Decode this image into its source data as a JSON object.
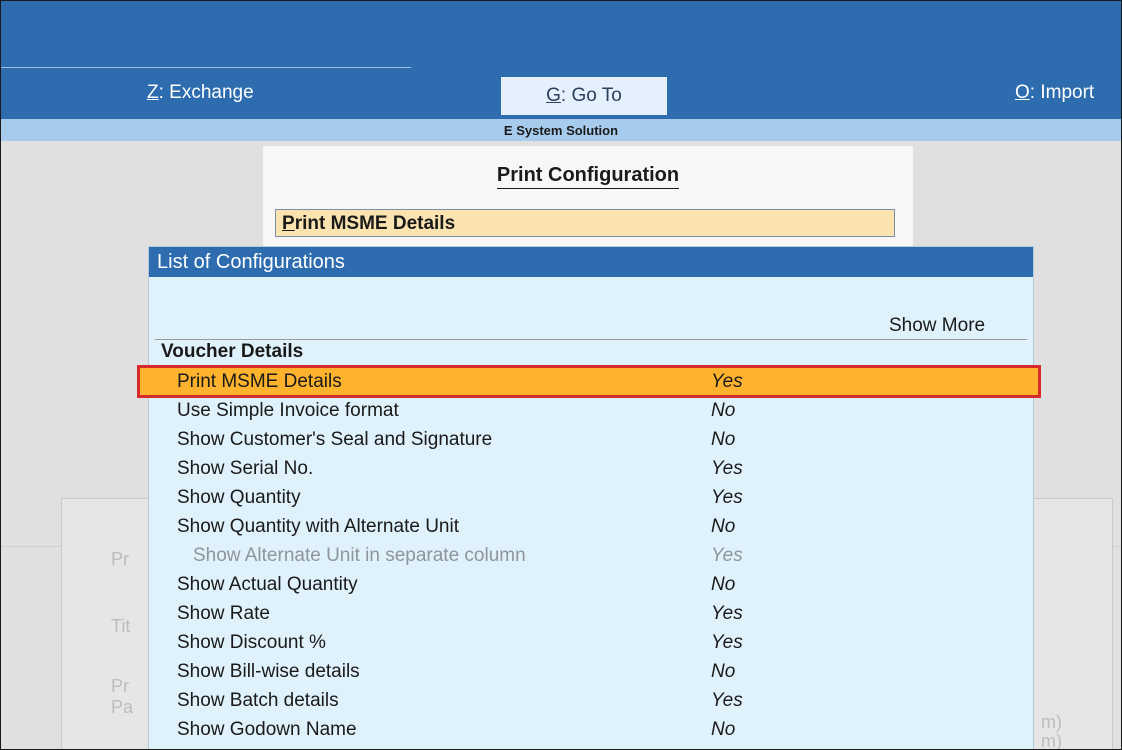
{
  "menu": {
    "exchange_key": "Z",
    "exchange_label": "Exchange",
    "goto_key": "G",
    "goto_label": "Go To",
    "import_key": "O",
    "import_label": "Import"
  },
  "company_name": "E System Solution",
  "print_configuration": {
    "title": "Print Configuration",
    "field_key": "P",
    "field_rest": "rint MSME Details"
  },
  "list": {
    "title": "List of Configurations",
    "show_more": "Show More",
    "section": "Voucher Details",
    "rows": [
      {
        "label": "Print MSME Details",
        "value": "Yes"
      },
      {
        "label": "Use Simple Invoice format",
        "value": "No"
      },
      {
        "label": "Show Customer's Seal and Signature",
        "value": "No"
      },
      {
        "label": "Show Serial No.",
        "value": "Yes"
      },
      {
        "label": "Show Quantity",
        "value": "Yes"
      },
      {
        "label": "Show Quantity with Alternate Unit",
        "value": "No"
      },
      {
        "label": "Show Alternate Unit in separate column",
        "value": "Yes"
      },
      {
        "label": "Show Actual Quantity",
        "value": "No"
      },
      {
        "label": "Show Rate",
        "value": "Yes"
      },
      {
        "label": "Show Discount %",
        "value": "Yes"
      },
      {
        "label": "Show Bill-wise details",
        "value": "No"
      },
      {
        "label": "Show Batch details",
        "value": "Yes"
      },
      {
        "label": "Show Godown Name",
        "value": "No"
      }
    ]
  },
  "background_text": {
    "pr": "Pr",
    "tit": "Tit",
    "pr2": "Pr",
    "pa": "Pa",
    "m1": "m)",
    "m2": "m)"
  },
  "colors": {
    "topbar": "#2d6cae",
    "company_bar": "#a7cbec",
    "list_bg": "#dff1fb",
    "selected_row": "#fdb32d",
    "selected_outline": "#d72b2b",
    "field_highlight": "#fbe3b0"
  }
}
